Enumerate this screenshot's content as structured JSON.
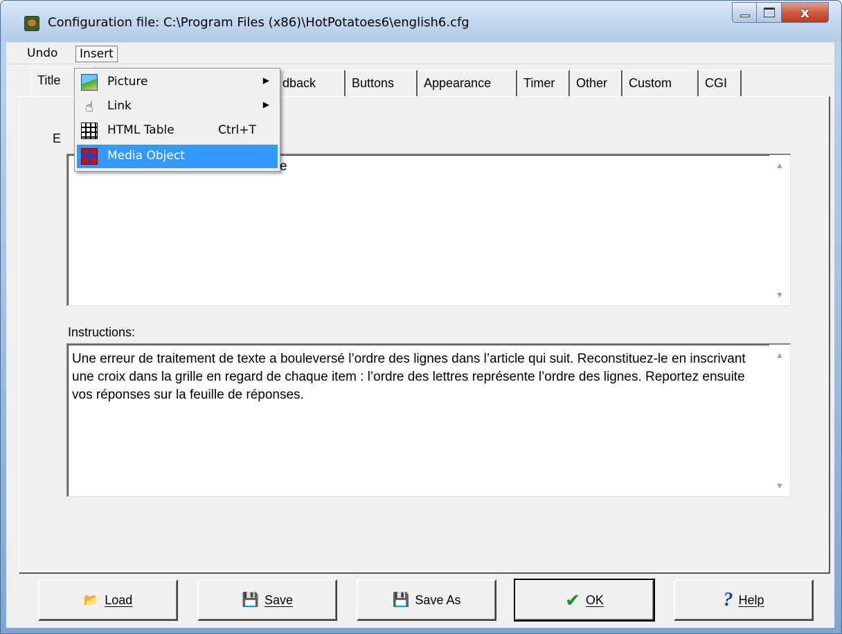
{
  "window": {
    "title": "Configuration file: C:\\Program Files (x86)\\HotPotatoes6\\english6.cfg",
    "close_glyph": "x",
    "accent": "#3399ff"
  },
  "menubar": {
    "undo": "Undo",
    "insert": "Insert"
  },
  "tabs": [
    {
      "label": "Title"
    },
    {
      "label": "Prompts/Feedback",
      "visible_fragment": "dback"
    },
    {
      "label": "Buttons"
    },
    {
      "label": "Appearance"
    },
    {
      "label": "Timer"
    },
    {
      "label": "Other"
    },
    {
      "label": "Custom"
    },
    {
      "label": "CGI"
    }
  ],
  "tab_fragments": {
    "title": "Title",
    "feedback": "dback"
  },
  "title_panel": {
    "subtitle_label_fragment": "E",
    "subtitle_value_fragment": "e",
    "instructions_label": "Instructions:",
    "instructions_value": "Une erreur de traitement de texte a bouleversé l’ordre des lignes dans l’article qui suit. Reconstituez-le en inscrivant une croix dans la grille en regard de chaque item : l’ordre des lettres représente l’ordre des lignes. Reportez ensuite vos réponses sur la feuille de réponses."
  },
  "insert_menu": {
    "items": [
      {
        "label": "Picture",
        "icon": "picture-icon",
        "submenu": true
      },
      {
        "label": "Link",
        "icon": "hand-pointer-icon",
        "submenu": true
      },
      {
        "label": "HTML Table",
        "icon": "table-icon",
        "shortcut": "Ctrl+T"
      },
      {
        "label": "Media Object",
        "icon": "gift-icon",
        "highlighted": true
      }
    ]
  },
  "buttons": {
    "load": "Load",
    "save": "Save",
    "save_as": "Save As",
    "ok": "OK",
    "help": "Help"
  }
}
